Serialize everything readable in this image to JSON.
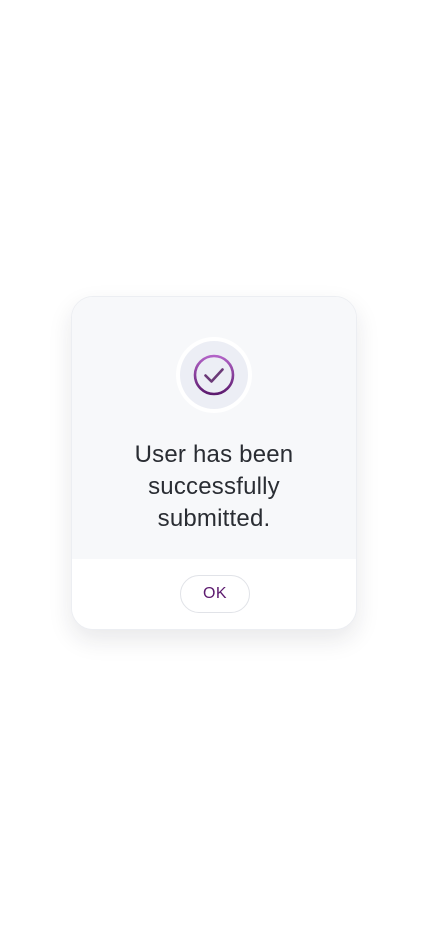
{
  "dialog": {
    "icon": "check-circle-icon",
    "message": "User has been successfully submitted.",
    "ok_label": "OK"
  },
  "colors": {
    "accent_dark": "#5c1a6e",
    "accent_light": "#a64cbf",
    "text": "#2a2d33"
  }
}
